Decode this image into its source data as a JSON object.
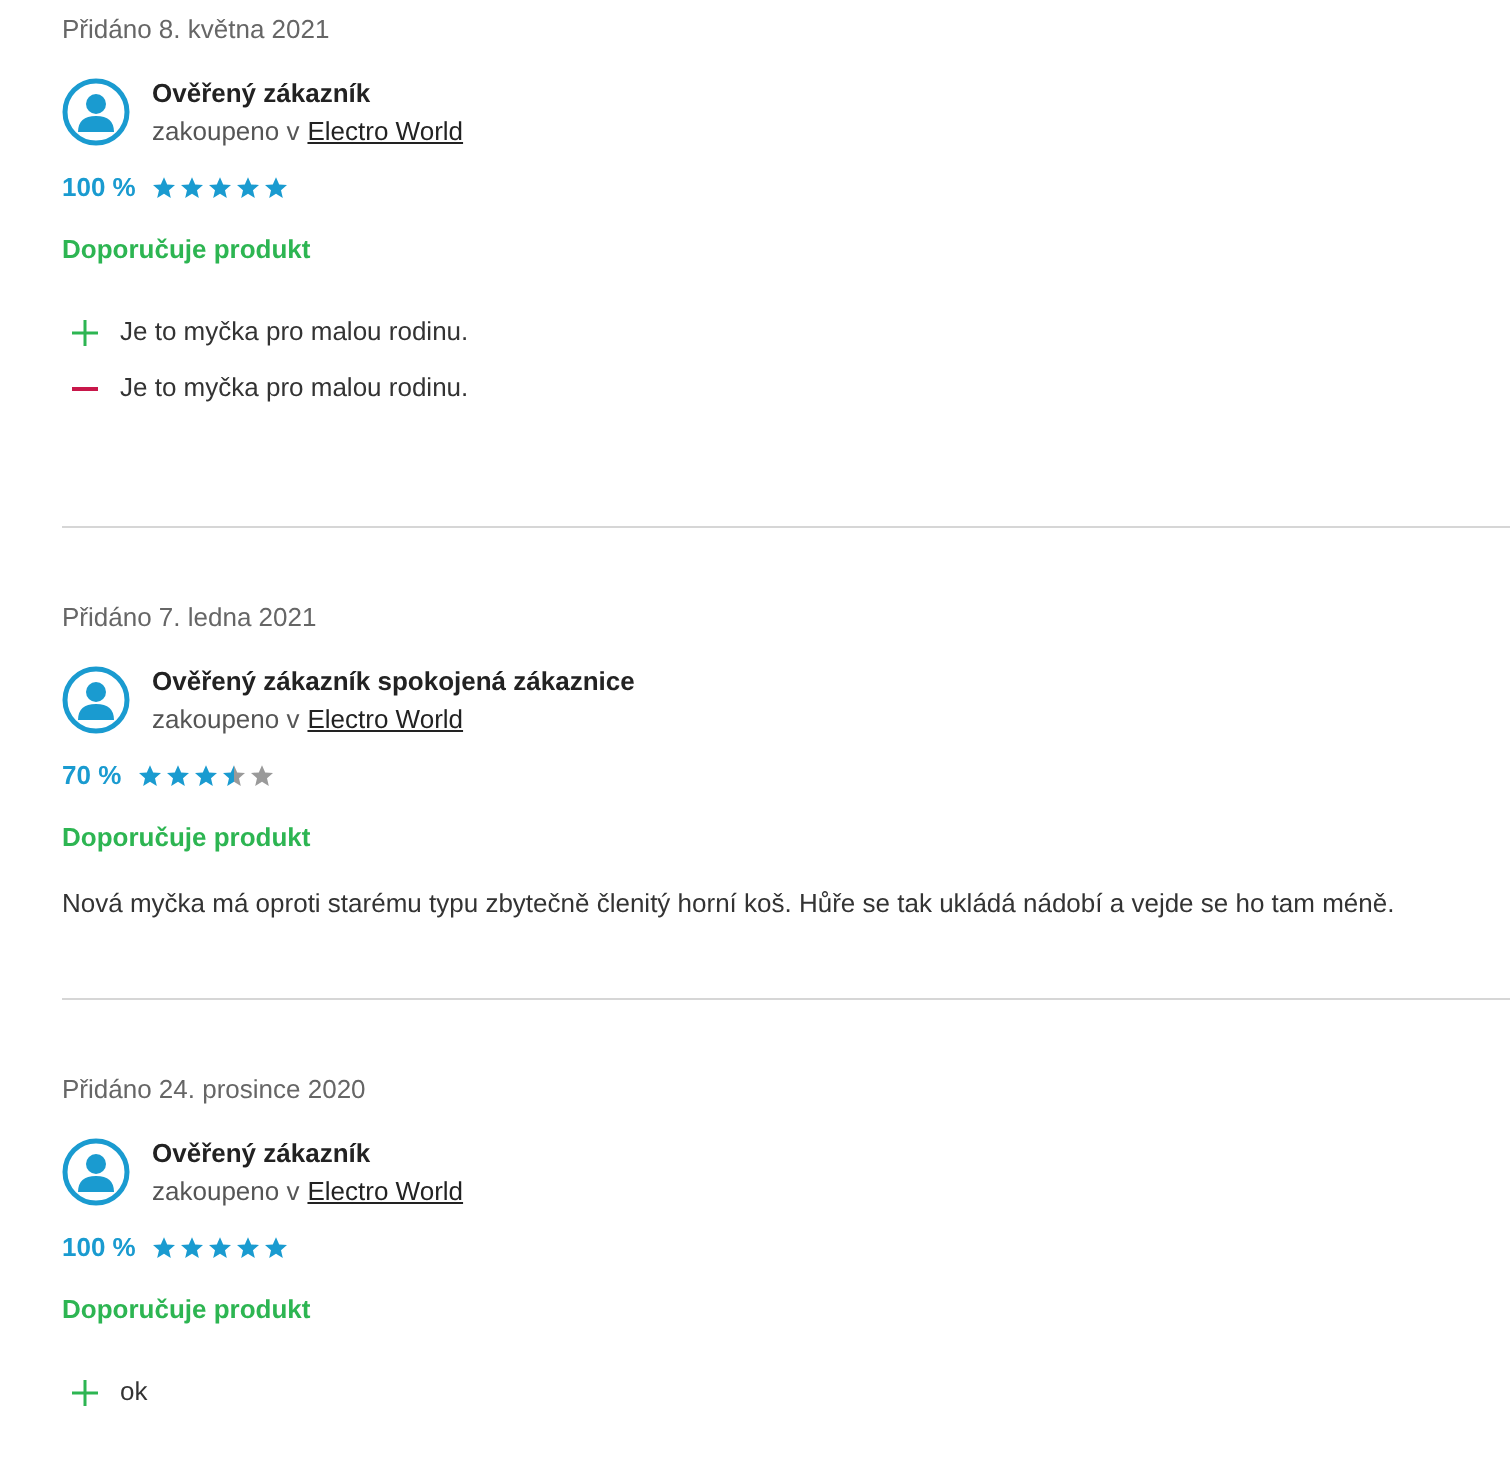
{
  "reviews": [
    {
      "date": "Přidáno 8. května 2021",
      "author": "Ověřený zákazník",
      "purchased": "zakoupeno v",
      "store": "Electro World",
      "score": "100 %",
      "stars": 5,
      "recommend": "Doporučuje produkt",
      "points": [
        {
          "kind": "pro",
          "text": "Je to myčka pro malou rodinu."
        },
        {
          "kind": "con",
          "text": "Je to myčka pro malou rodinu."
        }
      ]
    },
    {
      "date": "Přidáno 7. ledna 2021",
      "author": "Ověřený zákazník spokojená zákaznice",
      "purchased": "zakoupeno v",
      "store": "Electro World",
      "score": "70 %",
      "stars": 3.5,
      "recommend": "Doporučuje produkt",
      "comment": "Nová myčka má oproti starému typu zbytečně členitý horní koš. Hůře se tak ukládá nádobí a vejde se ho tam méně."
    },
    {
      "date": "Přidáno 24. prosince 2020",
      "author": "Ověřený zákazník",
      "purchased": "zakoupeno v",
      "store": "Electro World",
      "score": "100 %",
      "stars": 5,
      "recommend": "Doporučuje produkt",
      "points": [
        {
          "kind": "pro",
          "text": "ok"
        }
      ]
    }
  ]
}
